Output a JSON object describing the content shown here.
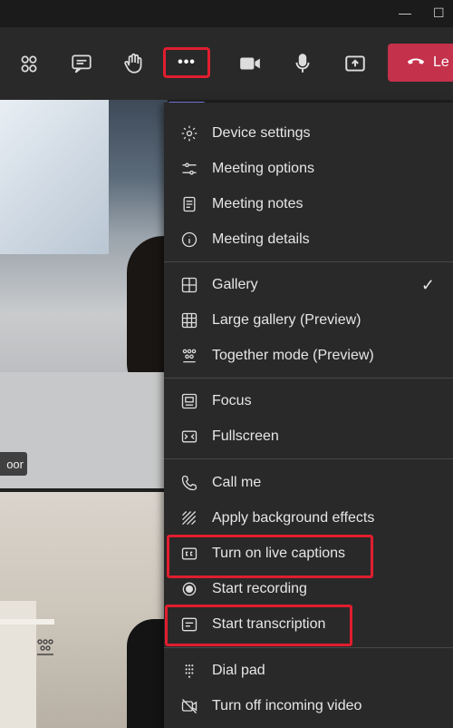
{
  "window": {
    "minimize_glyph": "—",
    "maximize_glyph": "☐"
  },
  "toolbar": {
    "more_glyph": "•••",
    "leave_label": "Le",
    "icons": [
      "people-icon",
      "chat-icon",
      "raise-hand-icon",
      "more-options-icon",
      "camera-icon",
      "microphone-icon",
      "share-screen-icon",
      "phone-hangup-icon"
    ]
  },
  "video": {
    "participant_name_fragment": "oor"
  },
  "menu": {
    "items": [
      {
        "label": "Device settings",
        "icon": "gear-icon"
      },
      {
        "label": "Meeting options",
        "icon": "sliders-icon"
      },
      {
        "label": "Meeting notes",
        "icon": "notes-icon"
      },
      {
        "label": "Meeting details",
        "icon": "info-icon"
      },
      {
        "label": "Gallery",
        "icon": "gallery-icon",
        "selected": true
      },
      {
        "label": "Large gallery (Preview)",
        "icon": "large-gallery-icon"
      },
      {
        "label": "Together mode (Preview)",
        "icon": "together-mode-icon"
      },
      {
        "label": "Focus",
        "icon": "focus-icon"
      },
      {
        "label": "Fullscreen",
        "icon": "fullscreen-icon"
      },
      {
        "label": "Call me",
        "icon": "phone-icon"
      },
      {
        "label": "Apply background effects",
        "icon": "background-effects-icon"
      },
      {
        "label": "Turn on live captions",
        "icon": "captions-icon"
      },
      {
        "label": "Start recording",
        "icon": "record-icon"
      },
      {
        "label": "Start transcription",
        "icon": "transcription-icon"
      },
      {
        "label": "Dial pad",
        "icon": "dialpad-icon"
      },
      {
        "label": "Turn off incoming video",
        "icon": "video-off-icon"
      }
    ],
    "check_glyph": "✓"
  },
  "colors": {
    "highlight": "#e01e2f",
    "leave": "#c4314b",
    "accent": "#7f85f5",
    "menu_bg": "#292929"
  }
}
